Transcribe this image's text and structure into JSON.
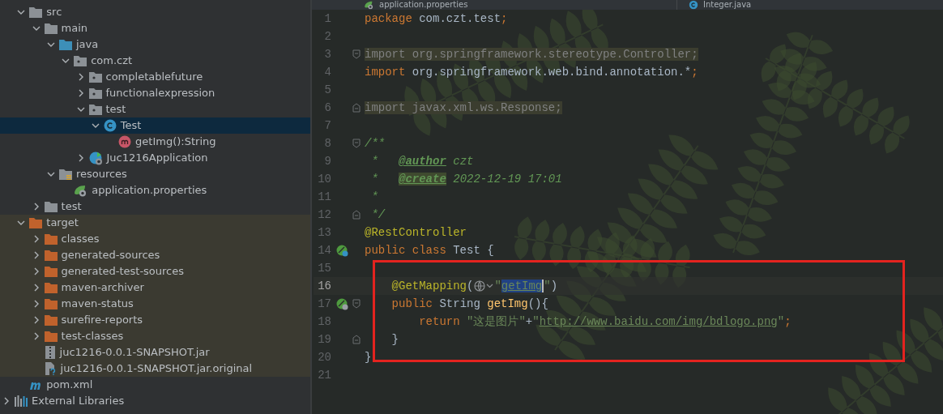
{
  "tree": {
    "project_items": [
      {
        "label": "src",
        "kind": "folder",
        "expanded": true,
        "selected": false,
        "children": [
          {
            "label": "main",
            "kind": "folder",
            "expanded": true,
            "selected": false,
            "children": [
              {
                "label": "java",
                "kind": "source-folder",
                "expanded": true,
                "selected": false,
                "children": [
                  {
                    "label": "com.czt",
                    "kind": "package",
                    "expanded": true,
                    "selected": false,
                    "children": [
                      {
                        "label": "completablefuture",
                        "kind": "package",
                        "expanded": false,
                        "selected": false
                      },
                      {
                        "label": "functionalexpression",
                        "kind": "package",
                        "expanded": false,
                        "selected": false
                      },
                      {
                        "label": "test",
                        "kind": "package",
                        "expanded": true,
                        "selected": false,
                        "children": [
                          {
                            "label": "Test",
                            "kind": "class",
                            "expanded": true,
                            "selected": true,
                            "children": [
                              {
                                "label": "getImg():String",
                                "kind": "method",
                                "selected": false
                              }
                            ]
                          }
                        ]
                      },
                      {
                        "label": "Juc1216Application",
                        "kind": "spring-class",
                        "expanded": false,
                        "selected": false
                      }
                    ]
                  }
                ]
              },
              {
                "label": "resources",
                "kind": "resources-folder",
                "expanded": true,
                "selected": false,
                "children": [
                  {
                    "label": "application.properties",
                    "kind": "properties",
                    "selected": false
                  }
                ]
              }
            ]
          },
          {
            "label": "test",
            "kind": "folder",
            "expanded": false,
            "selected": false
          }
        ]
      },
      {
        "label": "target",
        "kind": "excluded-folder",
        "expanded": true,
        "selected": false,
        "children": [
          {
            "label": "classes",
            "kind": "excluded-folder",
            "expanded": false,
            "selected": false
          },
          {
            "label": "generated-sources",
            "kind": "excluded-folder",
            "expanded": false,
            "selected": false
          },
          {
            "label": "generated-test-sources",
            "kind": "excluded-folder",
            "expanded": false,
            "selected": false
          },
          {
            "label": "maven-archiver",
            "kind": "excluded-folder",
            "expanded": false,
            "selected": false
          },
          {
            "label": "maven-status",
            "kind": "excluded-folder",
            "expanded": false,
            "selected": false
          },
          {
            "label": "surefire-reports",
            "kind": "excluded-folder",
            "expanded": false,
            "selected": false
          },
          {
            "label": "test-classes",
            "kind": "excluded-folder",
            "expanded": false,
            "selected": false
          },
          {
            "label": "juc1216-0.0.1-SNAPSHOT.jar",
            "kind": "jar",
            "selected": false
          },
          {
            "label": "juc1216-0.0.1-SNAPSHOT.jar.original",
            "kind": "unknown",
            "selected": false
          }
        ]
      },
      {
        "label": "pom.xml",
        "kind": "maven",
        "selected": false
      }
    ],
    "items": [
      {
        "label": "External Libraries",
        "kind": "libraries",
        "expanded": false,
        "selected": false
      }
    ]
  },
  "editor_tabs": [
    {
      "label": "application.properties",
      "kind": "properties",
      "selected": false
    },
    {
      "label": "Integer.java",
      "kind": "class",
      "selected": false
    }
  ],
  "code_lines": [
    {
      "number": "1",
      "tokens": [
        {
          "kind": "keyword",
          "text": "package "
        },
        {
          "kind": "plain",
          "text": "com.czt.test"
        },
        {
          "kind": "keyword",
          "text": ";"
        }
      ]
    },
    {
      "number": "2"
    },
    {
      "number": "3",
      "fold_open": true,
      "tokens": [
        {
          "kind": "unused",
          "text": "import org.springframework.stereotype.Controller;"
        }
      ]
    },
    {
      "number": "4",
      "tokens": [
        {
          "kind": "keyword",
          "text": "import "
        },
        {
          "kind": "plain",
          "text": "org.springframework.web.bind.annotation.*"
        },
        {
          "kind": "keyword",
          "text": ";"
        }
      ]
    },
    {
      "number": "5"
    },
    {
      "number": "6",
      "fold_close": true,
      "tokens": [
        {
          "kind": "unused",
          "text": "import javax.xml.ws.Response;"
        }
      ]
    },
    {
      "number": "7"
    },
    {
      "number": "8",
      "fold_open": true,
      "tokens": [
        {
          "kind": "doc",
          "text": "/**"
        }
      ]
    },
    {
      "number": "9",
      "tokens": [
        {
          "kind": "doc",
          "text": " *   "
        },
        {
          "kind": "doc-tag",
          "text": "@author"
        },
        {
          "kind": "doc",
          "text": " czt"
        }
      ]
    },
    {
      "number": "10",
      "tokens": [
        {
          "kind": "doc",
          "text": " *   "
        },
        {
          "kind": "doc-tag-match",
          "text": "@create"
        },
        {
          "kind": "doc",
          "text": " 2022-12-19 17:01"
        }
      ]
    },
    {
      "number": "11",
      "tokens": [
        {
          "kind": "doc",
          "text": " *"
        }
      ]
    },
    {
      "number": "12",
      "fold_close": true,
      "tokens": [
        {
          "kind": "doc",
          "text": " */"
        }
      ]
    },
    {
      "number": "13",
      "tokens": [
        {
          "kind": "annotation",
          "text": "@RestController"
        }
      ]
    },
    {
      "number": "14",
      "bean_icon": true,
      "tokens": [
        {
          "kind": "keyword",
          "text": "public class "
        },
        {
          "kind": "plain",
          "text": "Test {"
        }
      ]
    },
    {
      "number": "15"
    },
    {
      "number": "16",
      "current": true,
      "tokens": [
        {
          "kind": "annotation",
          "text": "    @GetMapping"
        },
        {
          "kind": "plain",
          "text": "("
        },
        {
          "kind": "inlay"
        },
        {
          "kind": "string",
          "text": "\""
        },
        {
          "kind": "selected-link",
          "text": "getImg"
        },
        {
          "kind": "string",
          "text": "\""
        },
        {
          "kind": "plain",
          "text": ")"
        }
      ]
    },
    {
      "number": "17",
      "web_bean_icon": true,
      "fold_open": true,
      "tokens": [
        {
          "kind": "keyword",
          "text": "    public "
        },
        {
          "kind": "plain",
          "text": "String "
        },
        {
          "kind": "method",
          "text": "getImg"
        },
        {
          "kind": "plain",
          "text": "(){"
        }
      ]
    },
    {
      "number": "18",
      "tokens": [
        {
          "kind": "keyword",
          "text": "        return "
        },
        {
          "kind": "string",
          "text": "\"这是图片\""
        },
        {
          "kind": "plain",
          "text": "+"
        },
        {
          "kind": "string",
          "text": "\""
        },
        {
          "kind": "link",
          "text": "http://www.baidu.com/img/bdlogo.png"
        },
        {
          "kind": "string",
          "text": "\""
        },
        {
          "kind": "keyword",
          "text": ";"
        }
      ]
    },
    {
      "number": "19",
      "fold_close": true,
      "tokens": [
        {
          "kind": "plain",
          "text": "    }"
        }
      ]
    },
    {
      "number": "20",
      "tokens": [
        {
          "kind": "plain",
          "text": "}"
        }
      ]
    },
    {
      "number": "21"
    }
  ]
}
